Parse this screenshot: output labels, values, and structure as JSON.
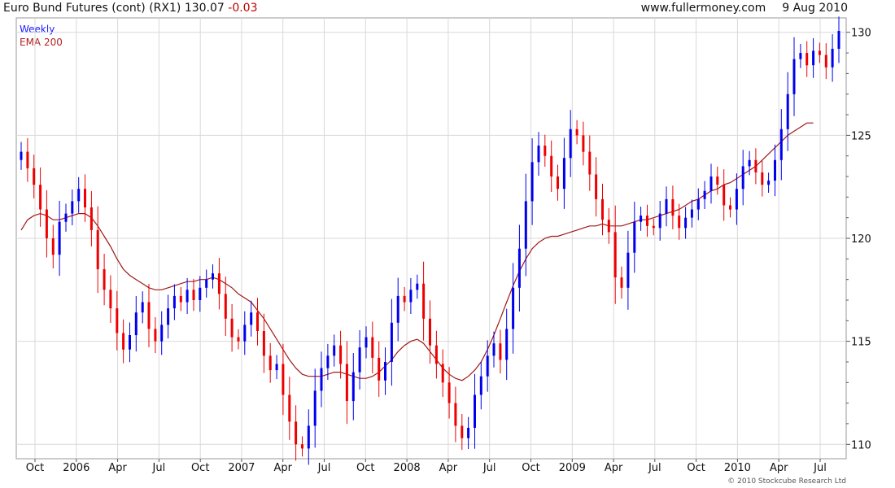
{
  "header": {
    "title": "Euro Bund Futures (cont) (RX1)",
    "last": "130.07",
    "change": "-0.03",
    "site": "www.fullermoney.com",
    "date": "9 Aug 2010"
  },
  "legend": {
    "weekly": "Weekly",
    "ema": "EMA 200"
  },
  "copyright": "© 2010 Stockcube Research Ltd",
  "colors": {
    "up": "#0000ee",
    "down": "#ee0000",
    "ema": "#a01818",
    "grid": "#d9d9d9"
  },
  "chart_data": {
    "type": "candlestick",
    "y_ticks": [
      110,
      115,
      120,
      125,
      130
    ],
    "ylim": [
      109.3,
      130.7
    ],
    "x_labels": [
      "Oct",
      "2006",
      "Apr",
      "Jul",
      "Oct",
      "2007",
      "Apr",
      "Jul",
      "Oct",
      "2008",
      "Apr",
      "Jul",
      "Oct",
      "2009",
      "Apr",
      "Jul",
      "Oct",
      "2010",
      "Apr",
      "Jul"
    ],
    "close_series": [
      124.2,
      123.4,
      122.6,
      121.4,
      120.0,
      119.2,
      120.8,
      121.2,
      121.8,
      122.4,
      121.5,
      120.4,
      118.5,
      117.5,
      116.6,
      115.4,
      114.6,
      115.3,
      116.4,
      116.9,
      115.6,
      115.0,
      115.8,
      116.6,
      117.2,
      116.9,
      117.5,
      117.0,
      117.6,
      118.0,
      118.3,
      117.3,
      116.1,
      115.2,
      115.0,
      115.8,
      116.4,
      115.5,
      114.3,
      113.6,
      113.9,
      112.4,
      111.1,
      110.0,
      109.8,
      110.9,
      112.6,
      113.7,
      114.3,
      114.8,
      113.9,
      112.1,
      113.5,
      114.7,
      115.2,
      114.2,
      113.1,
      114.0,
      115.9,
      117.2,
      116.9,
      117.5,
      117.8,
      116.1,
      114.8,
      113.9,
      113.0,
      112.0,
      110.9,
      110.3,
      110.8,
      112.4,
      113.3,
      114.3,
      114.9,
      114.1,
      115.6,
      117.6,
      119.5,
      121.8,
      123.7,
      124.5,
      124.0,
      123.0,
      122.4,
      123.9,
      125.3,
      125.0,
      124.2,
      123.1,
      121.9,
      120.9,
      120.3,
      118.1,
      117.6,
      119.3,
      120.8,
      121.1,
      120.6,
      120.5,
      121.2,
      121.9,
      121.1,
      120.5,
      121.0,
      121.4,
      121.9,
      122.3,
      123.0,
      122.6,
      121.6,
      121.4,
      122.4,
      123.5,
      123.8,
      123.2,
      122.6,
      122.8,
      123.8,
      125.3,
      127.0,
      128.7,
      129.0,
      128.4,
      129.1,
      128.9,
      128.3,
      129.2,
      130.07
    ],
    "series": [
      {
        "name": "Weekly",
        "kind": "candlestick"
      },
      {
        "name": "EMA 200",
        "kind": "line",
        "values": [
          120.4,
          120.9,
          121.1,
          121.2,
          121.1,
          120.9,
          120.9,
          121.0,
          121.1,
          121.2,
          121.2,
          121.0,
          120.6,
          120.1,
          119.6,
          119.0,
          118.5,
          118.2,
          118.0,
          117.8,
          117.6,
          117.5,
          117.5,
          117.6,
          117.7,
          117.8,
          117.9,
          117.9,
          118.0,
          118.0,
          118.1,
          118.0,
          117.8,
          117.6,
          117.3,
          117.1,
          116.9,
          116.5,
          116.1,
          115.6,
          115.1,
          114.6,
          114.1,
          113.7,
          113.4,
          113.3,
          113.3,
          113.3,
          113.4,
          113.5,
          113.5,
          113.4,
          113.3,
          113.2,
          113.2,
          113.3,
          113.5,
          113.8,
          114.1,
          114.5,
          114.8,
          115.0,
          115.1,
          114.9,
          114.5,
          114.1,
          113.7,
          113.4,
          113.2,
          113.1,
          113.3,
          113.6,
          114.0,
          114.6,
          115.3,
          116.1,
          116.9,
          117.7,
          118.4,
          119.0,
          119.5,
          119.8,
          120.0,
          120.1,
          120.1,
          120.2,
          120.3,
          120.4,
          120.5,
          120.6,
          120.6,
          120.7,
          120.6,
          120.6,
          120.6,
          120.7,
          120.8,
          120.9,
          120.9,
          121.0,
          121.1,
          121.2,
          121.3,
          121.4,
          121.6,
          121.8,
          121.9,
          122.1,
          122.3,
          122.4,
          122.6,
          122.7,
          122.9,
          123.1,
          123.3,
          123.5,
          123.8,
          124.1,
          124.4,
          124.7,
          125.0,
          125.2,
          125.4,
          125.6,
          125.6
        ]
      }
    ]
  }
}
